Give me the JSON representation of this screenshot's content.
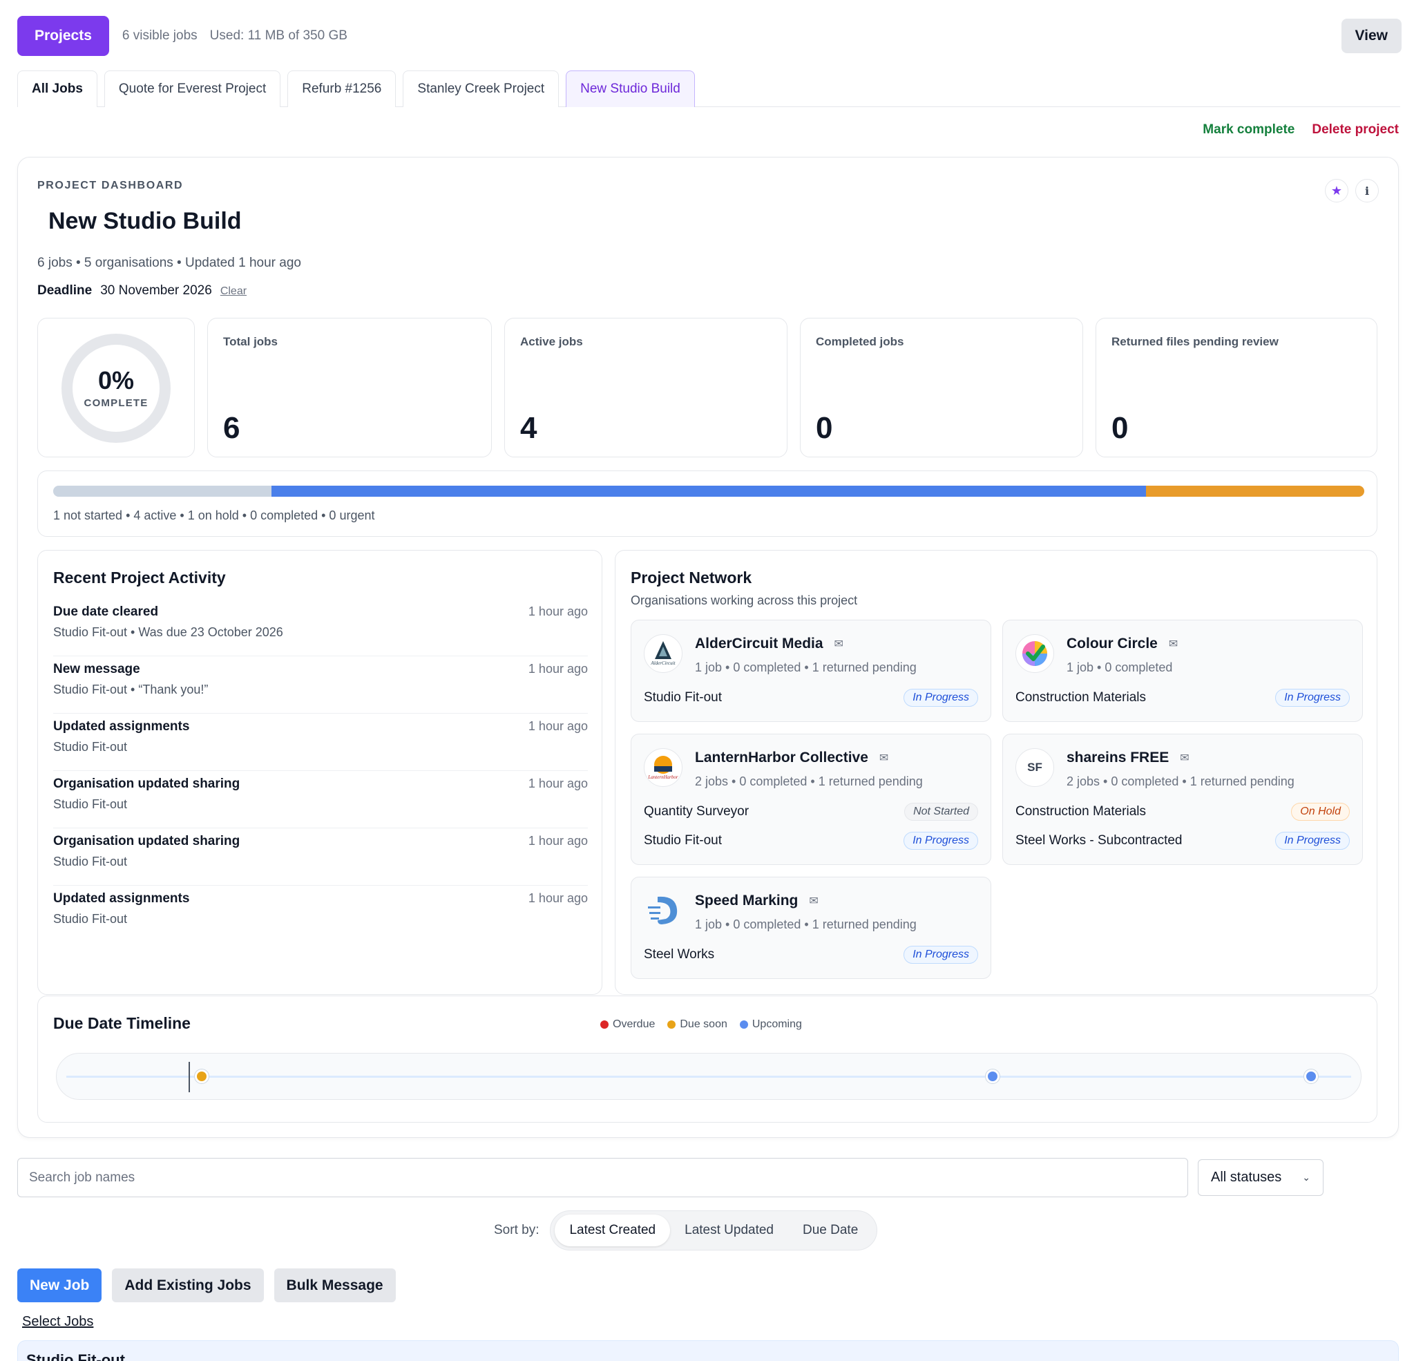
{
  "topbar": {
    "projects_label": "Projects",
    "visible_jobs": "6 visible jobs",
    "storage": "Used: 11 MB of 350 GB",
    "view_label": "View"
  },
  "tabs": [
    {
      "label": "All Jobs"
    },
    {
      "label": "Quote for Everest Project"
    },
    {
      "label": "Refurb #1256"
    },
    {
      "label": "Stanley Creek Project"
    },
    {
      "label": "New Studio Build"
    }
  ],
  "actions": {
    "mark_complete": "Mark complete",
    "delete_project": "Delete project"
  },
  "dashboard": {
    "label": "PROJECT DASHBOARD",
    "title": "New Studio Build",
    "subtitle": "6 jobs • 5 organisations • Updated 1 hour ago",
    "deadline_label": "Deadline",
    "deadline_value": "30 November 2026",
    "clear_label": "Clear",
    "star_icon": "★",
    "info_icon": "i",
    "complete_pct": "0%",
    "complete_label": "COMPLETE",
    "stats": [
      {
        "label": "Total jobs",
        "value": "6"
      },
      {
        "label": "Active jobs",
        "value": "4"
      },
      {
        "label": "Completed jobs",
        "value": "0"
      },
      {
        "label": "Returned files pending review",
        "value": "0"
      }
    ],
    "progress": {
      "segments": [
        {
          "name": "not started",
          "count": 1,
          "color": "#cbd5e1"
        },
        {
          "name": "active",
          "count": 4,
          "color": "#4a7fea"
        },
        {
          "name": "on hold",
          "count": 1,
          "color": "#e89b2a"
        }
      ],
      "caption": "1 not started • 4 active • 1 on hold • 0 completed • 0 urgent"
    }
  },
  "activity": {
    "title": "Recent Project Activity",
    "items": [
      {
        "title": "Due date cleared",
        "desc": "Studio Fit-out • Was due 23 October 2026",
        "time": "1 hour ago"
      },
      {
        "title": "New message",
        "desc": "Studio Fit-out • “Thank you!”",
        "time": "1 hour ago"
      },
      {
        "title": "Updated assignments",
        "desc": "Studio Fit-out",
        "time": "1 hour ago"
      },
      {
        "title": "Organisation updated sharing",
        "desc": "Studio Fit-out",
        "time": "1 hour ago"
      },
      {
        "title": "Organisation updated sharing",
        "desc": "Studio Fit-out",
        "time": "1 hour ago"
      },
      {
        "title": "Updated assignments",
        "desc": "Studio Fit-out",
        "time": "1 hour ago"
      }
    ]
  },
  "network": {
    "title": "Project Network",
    "subtitle": "Organisations working across this project",
    "mail_icon": "✉",
    "orgs": [
      {
        "name": "AlderCircuit Media",
        "stats": "1 job • 0 completed • 1 returned pending",
        "logo_text": "AlderCircuit",
        "jobs": [
          {
            "name": "Studio Fit-out",
            "status": "In Progress"
          }
        ]
      },
      {
        "name": "Colour Circle",
        "stats": "1 job • 0 completed",
        "jobs": [
          {
            "name": "Construction Materials",
            "status": "In Progress"
          }
        ]
      },
      {
        "name": "LanternHarbor Collective",
        "stats": "2 jobs • 0 completed • 1 returned pending",
        "logo_text": "LanternHarbor",
        "jobs": [
          {
            "name": "Quantity Surveyor",
            "status": "Not Started"
          },
          {
            "name": "Studio Fit-out",
            "status": "In Progress"
          }
        ]
      },
      {
        "name": "shareins FREE",
        "stats": "2 jobs • 0 completed • 1 returned pending",
        "logo_text": "SF",
        "jobs": [
          {
            "name": "Construction Materials",
            "status": "On Hold"
          },
          {
            "name": "Steel Works - Subcontracted",
            "status": "In Progress"
          }
        ]
      },
      {
        "name": "Speed Marking",
        "stats": "1 job • 0 completed • 1 returned pending",
        "jobs": [
          {
            "name": "Steel Works",
            "status": "In Progress"
          }
        ]
      }
    ]
  },
  "timeline": {
    "title": "Due Date Timeline",
    "legend": [
      {
        "label": "Overdue",
        "color": "#dc2626"
      },
      {
        "label": "Due soon",
        "color": "#e8a317"
      },
      {
        "label": "Upcoming",
        "color": "#5b8def"
      }
    ],
    "points": [
      {
        "fraction": 0.105,
        "kind": "due-soon",
        "color": "#e8a317"
      },
      {
        "fraction": 0.72,
        "kind": "upcoming",
        "color": "#5b8def"
      },
      {
        "fraction": 0.968,
        "kind": "upcoming",
        "color": "#5b8def"
      }
    ],
    "today_fraction": 0.095
  },
  "filters": {
    "search_placeholder": "Search job names",
    "status_selected": "All statuses",
    "chevron_icon": "⌄",
    "sort_label": "Sort by:",
    "sort_options": [
      {
        "label": "Latest Created"
      },
      {
        "label": "Latest Updated"
      },
      {
        "label": "Due Date"
      }
    ]
  },
  "job_actions": {
    "new_job": "New Job",
    "add_existing": "Add Existing Jobs",
    "bulk_message": "Bulk Message",
    "select_jobs": "Select Jobs"
  },
  "section": {
    "title": "Studio Fit-out"
  }
}
